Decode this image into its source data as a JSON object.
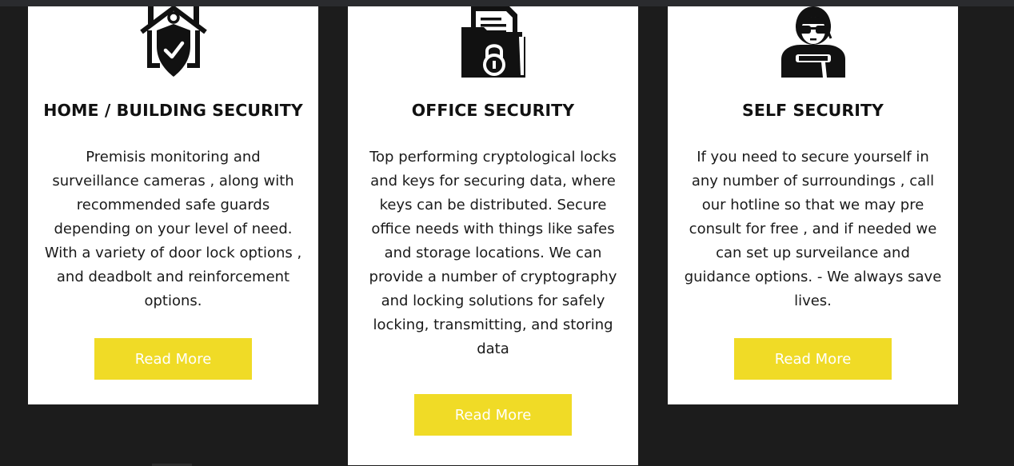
{
  "cards": [
    {
      "icon": "home-security-icon",
      "title": "HOME / BUILDING SECURITY",
      "description": "Premisis monitoring and surveillance cameras , along with recommended safe guards depending on your level of need. With a variety of door lock options , and deadbolt and reinforcement options.",
      "button_label": "Read More"
    },
    {
      "icon": "locked-folder-icon",
      "title": "OFFICE SECURITY",
      "description": "Top performing cryptological locks and keys for securing data, where keys can be distributed. Secure office needs with things like safes and storage locations. We can provide a number of cryptography and locking solutions for safely locking, transmitting, and storing data",
      "button_label": "Read More"
    },
    {
      "icon": "self-security-person-icon",
      "title": "SELF SECURITY",
      "description": "If you need to secure yourself in any number of surroundings , call our hotline so that we may pre consult for free , and if needed we can set up surveilance and guidance options. - We always save lives.",
      "button_label": "Read More"
    }
  ],
  "colors": {
    "background": "#1c1c1c",
    "card": "#ffffff",
    "accent": "#f0db26",
    "text": "#111111"
  }
}
